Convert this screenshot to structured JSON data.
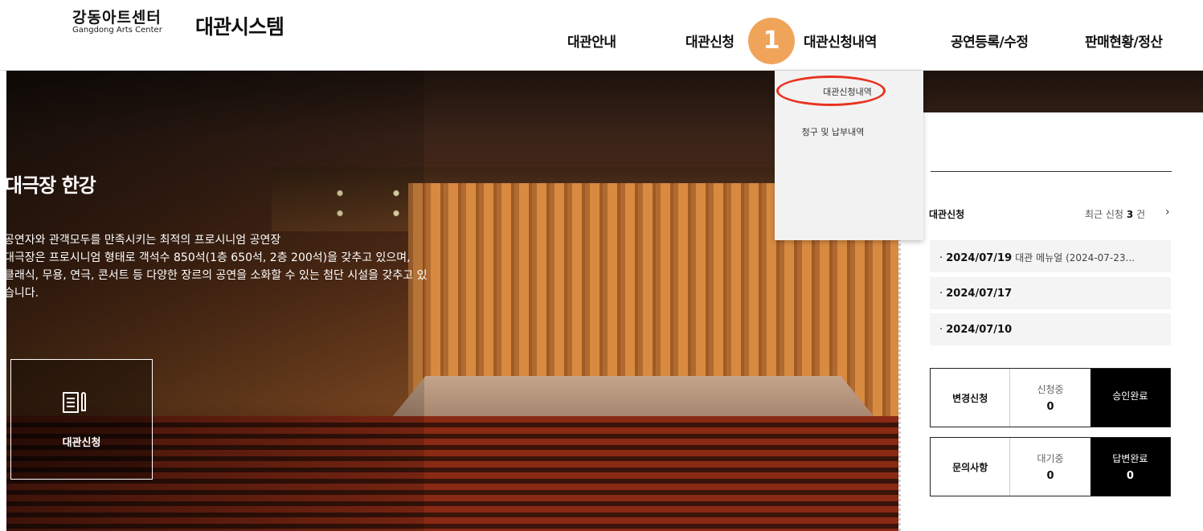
{
  "header": {
    "logo_ko": "강동아트센터",
    "logo_en": "Gangdong Arts Center",
    "system_title": "대관시스템"
  },
  "nav": [
    "대관안내",
    "대관신청",
    "대관신청내역",
    "공연등록/수정",
    "판매현황/정산"
  ],
  "step_badge": "1",
  "dropdown": {
    "items": [
      "대관신청내역",
      "청구 및 납부내역"
    ]
  },
  "hero": {
    "title": "대극장 한강",
    "desc": [
      "공연자와 관객모두를 만족시키는 최적의 프로시니엄 공연장",
      "대극장은 프로시니엄 형태로 객석수 850석(1층 650석, 2층 200석)을 갖추고 있으며,",
      "클래식, 무용, 연극, 콘서트 등 다양한 장르의 공연을 소화할 수 있는 첨단 시설을 갖추고 있",
      "습니다."
    ],
    "apply_label": "대관신청"
  },
  "panel": {
    "section_title": "대관신청",
    "recent_prefix": "최근 신청",
    "recent_count": "3",
    "recent_suffix": "건",
    "requests": [
      {
        "date": "2024/07/19",
        "note": "대관 메뉴얼 (2024-07-23..."
      },
      {
        "date": "2024/07/17",
        "note": ""
      },
      {
        "date": "2024/07/10",
        "note": ""
      }
    ],
    "change": {
      "label": "변경신청",
      "mid_label": "신청중",
      "mid_value": "0",
      "right_label": "승인완료",
      "right_value": ""
    },
    "inquiry": {
      "label": "문의사항",
      "mid_label": "대기중",
      "mid_value": "0",
      "right_label": "답변완료",
      "right_value": "0"
    }
  },
  "colors": {
    "badge": "#f0a45a",
    "highlight": "#e8321e"
  }
}
